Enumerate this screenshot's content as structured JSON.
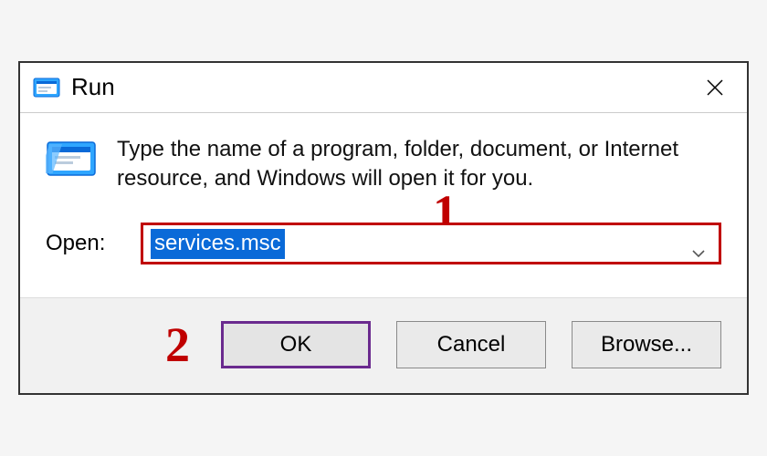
{
  "title": "Run",
  "description": "Type the name of a program, folder, document, or Internet resource, and Windows will open it for you.",
  "open_label": "Open:",
  "input_value": "services.msc",
  "buttons": {
    "ok": "OK",
    "cancel": "Cancel",
    "browse": "Browse..."
  },
  "annotations": {
    "one": "1",
    "two": "2"
  },
  "icons": {
    "run": "run-icon",
    "close": "close-icon",
    "chevron": "chevron-down-icon"
  }
}
